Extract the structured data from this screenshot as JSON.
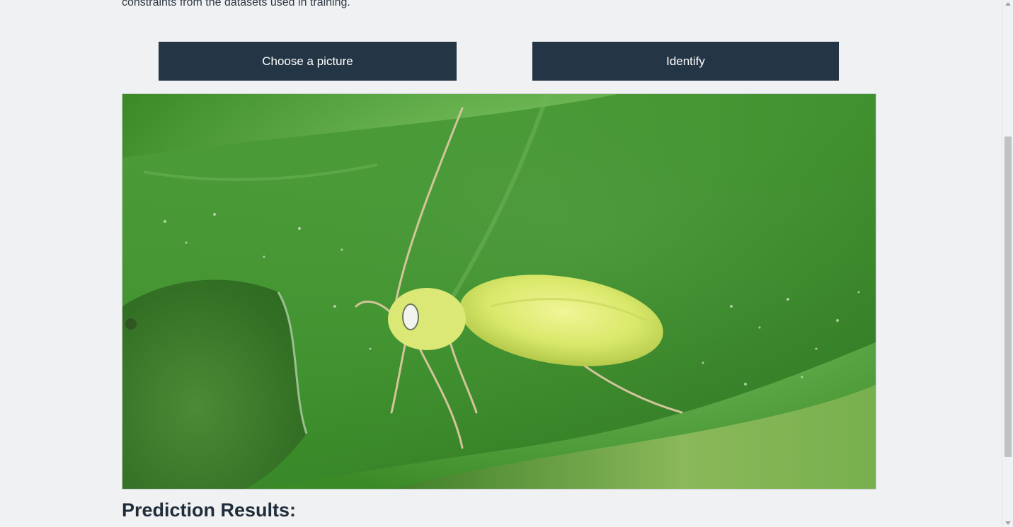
{
  "intro": {
    "text": "constraints from the datasets used in training."
  },
  "actions": {
    "choose_label": "Choose a picture",
    "identify_label": "Identify"
  },
  "results": {
    "heading": "Prediction Results:"
  },
  "colors": {
    "button_bg": "#243645",
    "page_bg": "#f0f1f3"
  }
}
